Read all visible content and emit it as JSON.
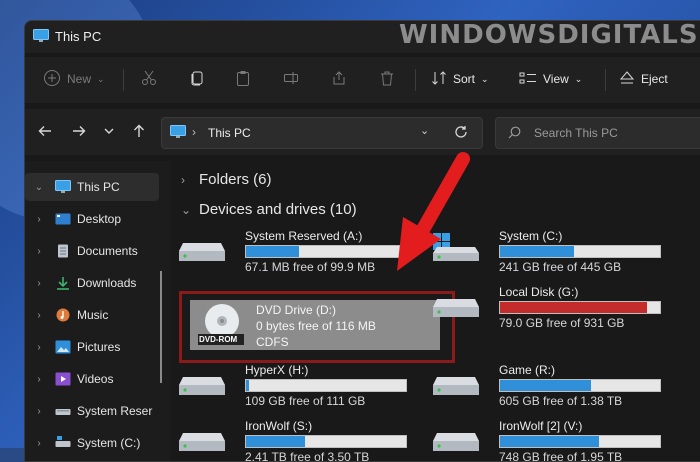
{
  "window": {
    "title": "This PC",
    "watermark": "WindowsDigitals.com"
  },
  "toolbar": {
    "new_label": "New",
    "sort_label": "Sort",
    "view_label": "View",
    "eject_label": "Eject"
  },
  "address": {
    "location": "This PC",
    "search_placeholder": "Search This PC"
  },
  "sidebar": {
    "items": [
      {
        "label": "This PC"
      },
      {
        "label": "Desktop"
      },
      {
        "label": "Documents"
      },
      {
        "label": "Downloads"
      },
      {
        "label": "Music"
      },
      {
        "label": "Pictures"
      },
      {
        "label": "Videos"
      },
      {
        "label": "System Reser"
      },
      {
        "label": "System (C:)"
      }
    ]
  },
  "content": {
    "folders_header": "Folders (6)",
    "devices_header": "Devices and drives (10)",
    "drives": [
      {
        "name": "System Reserved (A:)",
        "free": "67.1 MB free of 99.9 MB",
        "used_fraction": 0.33,
        "color": "#2f8fd8"
      },
      {
        "name": "System (C:)",
        "free": "241 GB free of 445 GB",
        "used_fraction": 0.46,
        "color": "#2f8fd8"
      },
      {
        "name": "DVD Drive (D:)",
        "free": "0 bytes free of 116 MB",
        "fs": "CDFS",
        "badge": "DVD-ROM"
      },
      {
        "name": "Local Disk (G:)",
        "free": "79.0 GB free of 931 GB",
        "used_fraction": 0.92,
        "color": "#c42b2b"
      },
      {
        "name": "HyperX (H:)",
        "free": "109 GB free of 111 GB",
        "used_fraction": 0.02,
        "color": "#2f8fd8"
      },
      {
        "name": "Game (R:)",
        "free": "605 GB free of 1.38 TB",
        "used_fraction": 0.57,
        "color": "#2f8fd8"
      },
      {
        "name": "IronWolf (S:)",
        "free": "2.41 TB free of 3.50 TB",
        "used_fraction": 0.37,
        "color": "#2f8fd8"
      },
      {
        "name": "IronWolf [2] (V:)",
        "free": "748 GB free of 1.95 TB",
        "used_fraction": 0.62,
        "color": "#2f8fd8"
      }
    ]
  }
}
